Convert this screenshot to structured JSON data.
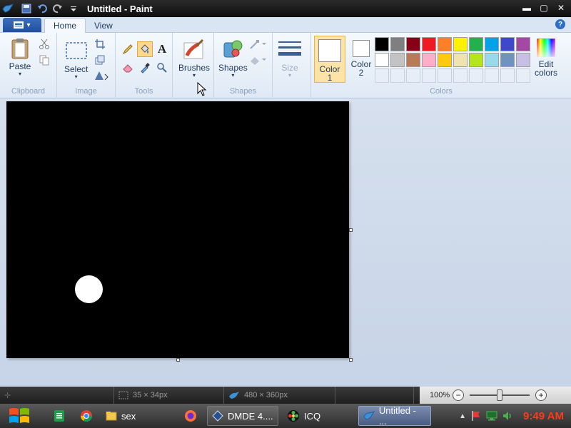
{
  "window": {
    "title": "Untitled - Paint"
  },
  "tabs": [
    {
      "label": "Home"
    },
    {
      "label": "View"
    }
  ],
  "ribbon": {
    "clipboard": {
      "paste": "Paste",
      "group": "Clipboard"
    },
    "image": {
      "select": "Select",
      "group": "Image"
    },
    "tools": {
      "group": "Tools",
      "text_tool": "A"
    },
    "brushes": {
      "label": "Brushes"
    },
    "shapes": {
      "label": "Shapes",
      "group": "Shapes"
    },
    "size": {
      "label": "Size"
    },
    "colors": {
      "color1": "Color 1",
      "color2": "Color 2",
      "edit": "Edit colors",
      "group": "Colors",
      "color1_value": "#ffffff",
      "color2_value": "#ffffff",
      "palette": [
        "#000000",
        "#7f7f7f",
        "#880015",
        "#ed1c24",
        "#ff7f27",
        "#fff200",
        "#22b14c",
        "#00a2e8",
        "#3f48cc",
        "#a349a4",
        "#ffffff",
        "#c3c3c3",
        "#b97a57",
        "#ffaec9",
        "#ffc90e",
        "#efe4b0",
        "#b5e61d",
        "#99d9ea",
        "#7092be",
        "#c8bfe7"
      ]
    }
  },
  "canvas": {
    "background": "#000000",
    "shape_color": "#ffffff"
  },
  "statusbar": {
    "selection_size": "35 × 34px",
    "image_size": "480 × 360px",
    "zoom": "100%"
  },
  "taskbar": {
    "items": [
      {
        "label": "sex"
      },
      {
        "label": "DMDE 4...."
      },
      {
        "label": "ICQ"
      },
      {
        "label": "Untitled - ..."
      }
    ],
    "clock": "9:49 AM"
  }
}
